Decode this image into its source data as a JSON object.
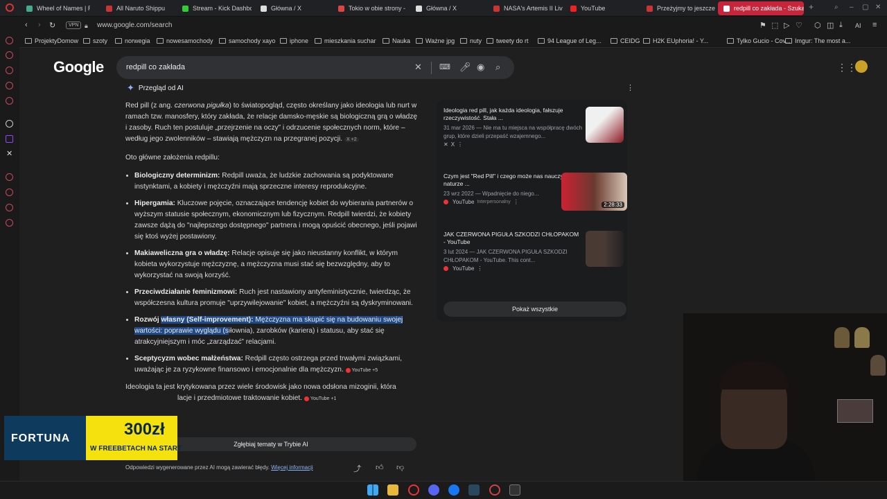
{
  "tabs": [
    {
      "label": "Wheel of Names | Ran",
      "color": "#4a8"
    },
    {
      "label": "All Naruto Shippu",
      "color": "#c33"
    },
    {
      "label": "Stream - Kick Dashbo",
      "color": "#3c3"
    },
    {
      "label": "Główna / X",
      "color": "#ddd"
    },
    {
      "label": "Tokio w obie strony -",
      "color": "#d44"
    },
    {
      "label": "Główna / X",
      "color": "#ddd"
    },
    {
      "label": "NASA's Artemis II Live",
      "color": "#c33"
    },
    {
      "label": "YouTube",
      "color": "#e22"
    },
    {
      "label": "Przeżyjmy to jeszcze",
      "color": "#c33"
    },
    {
      "label": "redpill co zakłada - Szukaj",
      "color": "#fff"
    }
  ],
  "tab_new": "+",
  "address": {
    "vpn": "VPN",
    "url": "www.google.com/search",
    "ai": "AI"
  },
  "bookmarks": [
    "ProjektyDomow",
    "szoty",
    "norwegia",
    "nowesamochody",
    "samochody xayo",
    "iphone",
    "mieszkania suchar",
    "Nauka",
    "Ważne jpg",
    "nuty",
    "tweety do rt",
    "94 League of Leg...",
    "CEIDG",
    "H2K EUphoria! - Y...",
    "Tylko Gucio - Cov...",
    "Imgur: The most a..."
  ],
  "google": {
    "logo": "Google",
    "query": "redpill co zakłada"
  },
  "ai_overview": {
    "header": "Przegląd od AI",
    "intro_a": "Red pill (z ang. ",
    "intro_em": "czerwona pigułka",
    "intro_b": ") to światopogląd, często określany jako ideologia lub nurt w ramach tzw. manosfery, który zakłada, że relacje damsko-męskie są biologiczną grą o władzę i zasoby. Ruch ten postuluje „przejrzenie na oczy” i odrzucenie społecznych norm, które – według jego zwolenników – stawiają mężczyzn na przegranej pozycji.",
    "intro_chip": "X +2",
    "lead": "Oto główne założenia redpillu:",
    "items": [
      {
        "title": "Biologiczny determinizm:",
        "text": " Redpill uważa, że ludzkie zachowania są podyktowane instynktami, a kobiety i mężczyźni mają sprzeczne interesy reprodukcyjne."
      },
      {
        "title": "Hipergamia:",
        "text": " Kluczowe pojęcie, oznaczające tendencję kobiet do wybierania partnerów o wyższym statusie społecznym, ekonomicznym lub fizycznym. Redpill twierdzi, że kobiety zawsze dążą do \"najlepszego dostępnego\" partnera i mogą opuścić obecnego, jeśli pojawi się ktoś wyżej postawiony."
      },
      {
        "title": "Makiaweliczna gra o władzę:",
        "text": " Relacje opisuje się jako nieustanny konflikt, w którym kobieta wykorzystuje mężczyznę, a mężczyzna musi stać się bezwzględny, aby to wykorzystać na swoją korzyść."
      },
      {
        "title": "Przeciwdziałanie feminizmowi:",
        "text": " Ruch jest nastawiony antyfeministycznie, twierdząc, że współczesna kultura promuje \"uprzywilejowanie\" kobiet, a mężczyźni są dyskryminowani."
      }
    ],
    "item5_pre": "Rozwój ",
    "item5_hl_title": "własny (Self-improvement):",
    "item5_hl_text": " Mężczyzna ma skupić się na budowaniu swojej wartości: poprawie wyglądu (s",
    "item5_rest": "iłownia), zarobków (kariera) i statusu, aby stać się atrakcyjniejszym i móc „zarządzać” relacjami.",
    "item6_title": "Sceptycyzm wobec małżeństwa:",
    "item6_text": " Redpill często ostrzega przed trwałymi związkami, uważając je za ryzykowne finansowo i emocjonalnie dla mężczyzn.",
    "item6_chip": "YouTube +5",
    "closing": "Ideologia ta jest krytykowana przez wiele środowisk jako nowa odsłona mizoginii, która",
    "closing2": "lacje i przedmiotowe traktowanie kobiet.",
    "closing_chip": "YouTube +1",
    "deep_button": "Zgłębiaj tematy w Trybie AI",
    "disclaimer": "Odpowiedzi wygenerowane przez AI mogą zawierać błędy.",
    "more_link": "Więcej informacji"
  },
  "sources": [
    {
      "title": "Ideologia red pill, jak każda ideologia, fałszuje rzeczywistość. Stała ...",
      "desc": "31 mar 2026 — Nie ma tu miejsca na współpracę dwóch grup, które dzieli przepaść wzajemnego...",
      "source": "X",
      "thumb": "#8a1a22"
    },
    {
      "title": "Czym jest \"Red Pill\" i czego może nas nauczyć o naturze ...",
      "desc": "23 wrz 2022 — Wpadnięcie do niego...",
      "source": "YouTube",
      "sub": "Interpersonalny",
      "duration": "2:28:33",
      "thumb": "#6a3a30"
    },
    {
      "title": "JAK CZERWONA PIGUŁA SZKODZI CHŁOPAKOM - YouTube",
      "desc": "3 lut 2024 — JAK CZERWONA PIGUŁA SZKODZI CHŁOPAKOM - YouTube. This cont...",
      "source": "YouTube",
      "thumb": "#4a3a34"
    }
  ],
  "show_all": "Pokaż wszystkie",
  "ad": {
    "brand": "FORTUNA",
    "amount": "300zł",
    "tagline": "W FREEBETACH NA START"
  }
}
